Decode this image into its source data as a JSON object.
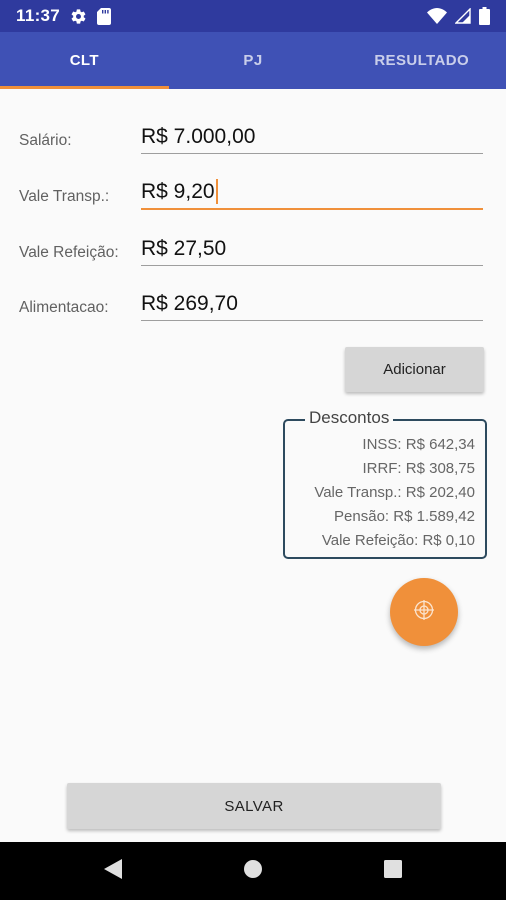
{
  "status_bar": {
    "time": "11:37",
    "icons": [
      "gear-icon",
      "sd-card-icon",
      "wifi-icon",
      "signal-icon",
      "battery-icon"
    ]
  },
  "tabs": [
    {
      "label": "CLT",
      "active": true
    },
    {
      "label": "PJ",
      "active": false
    },
    {
      "label": "RESULTADO",
      "active": false
    }
  ],
  "form": {
    "salario": {
      "label": "Salário:",
      "value": "R$ 7.000,00"
    },
    "vale_transp": {
      "label": "Vale Transp.:",
      "value": "R$ 9,20"
    },
    "vale_refeicao": {
      "label": "Vale Refeição:",
      "value": "R$ 27,50"
    },
    "alimentacao": {
      "label": "Alimentacao:",
      "value": "R$ 269,70"
    }
  },
  "buttons": {
    "adicionar": "Adicionar",
    "salvar": "SALVAR"
  },
  "descontos": {
    "title": "Descontos",
    "items": [
      "INSS: R$ 642,34",
      "IRRF: R$ 308,75",
      "Vale Transp.: R$ 202,40",
      "Pensão: R$ 1.589,42",
      "Vale Refeição: R$ 0,10"
    ]
  },
  "colors": {
    "primary": "#3f51b5",
    "primary_dark": "#2f3a9e",
    "accent": "#f0903a"
  },
  "fab_icon": "crosshair-icon",
  "nav_icons": [
    "back-icon",
    "home-icon",
    "recents-icon"
  ]
}
